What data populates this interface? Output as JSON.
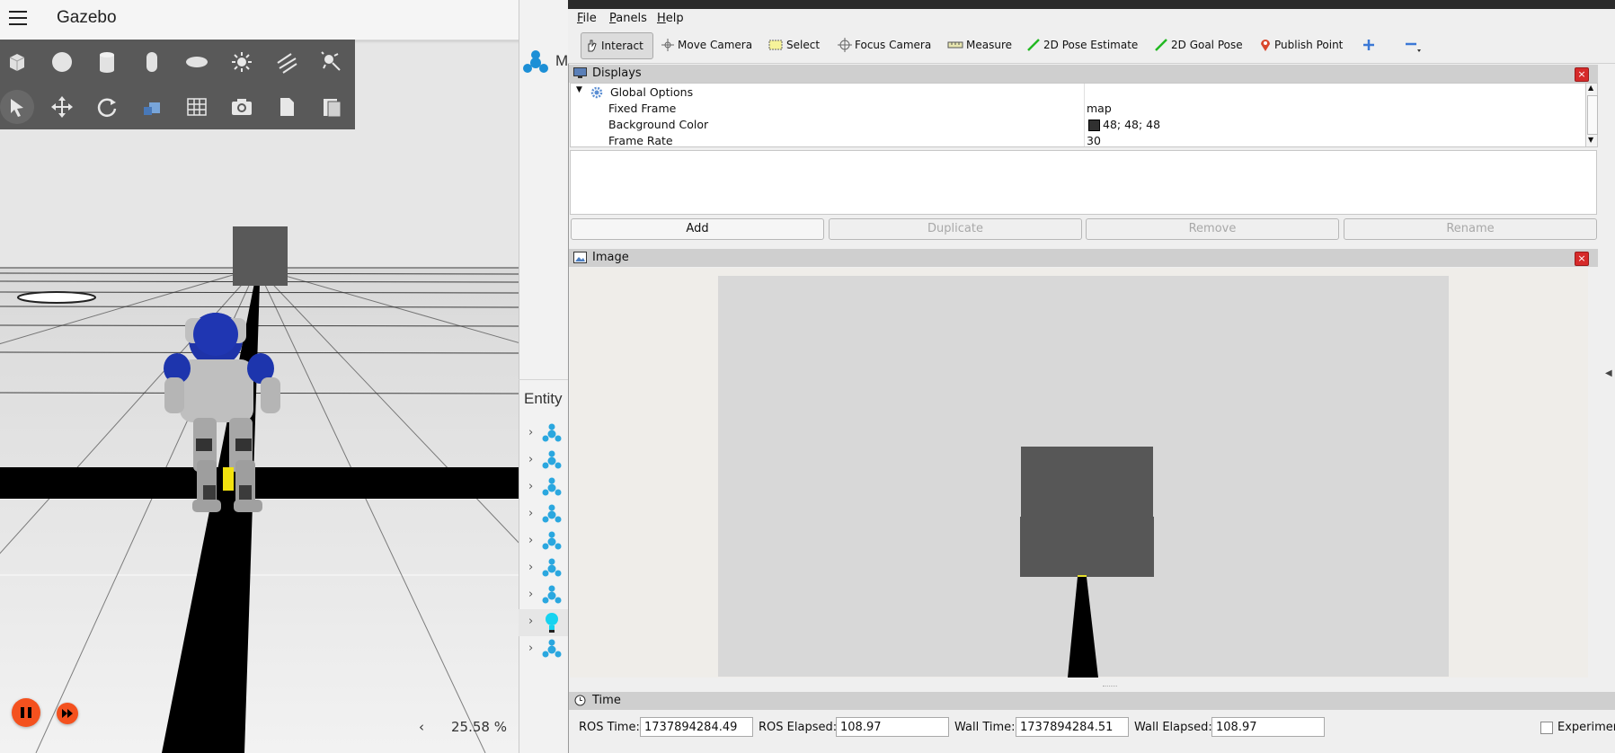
{
  "gazebo": {
    "title": "Gazebo",
    "side_panel_title_fragment": "M",
    "entity_title": "Entity",
    "zoom_level": "25.58 %",
    "zoom_chevron": "‹",
    "colors": {
      "fab": "#f4511e",
      "toolbar": "#4e4e4e"
    },
    "toolbar_row1_icons": [
      "box-icon",
      "sphere-icon",
      "cylinder-icon",
      "capsule-icon",
      "ellipsoid-icon",
      "sun-light-icon",
      "directional-light-icon",
      "spot-light-icon"
    ],
    "toolbar_row2_icons": [
      "select-arrow-icon",
      "translate-icon",
      "rotate-icon",
      "view-angle-icon",
      "grid-snap-icon",
      "screenshot-icon",
      "copy-icon",
      "paste-icon"
    ],
    "entity_icons": [
      "model-icon",
      "model-icon",
      "model-icon",
      "model-icon",
      "model-icon",
      "model-icon",
      "model-icon",
      "light-bulb-icon",
      "model-icon"
    ]
  },
  "rviz": {
    "menu": {
      "file": "File",
      "panels": "Panels",
      "help": "Help"
    },
    "tools": {
      "interact": "Interact",
      "move_camera": "Move Camera",
      "select": "Select",
      "focus_camera": "Focus Camera",
      "measure": "Measure",
      "pose_estimate": "2D Pose Estimate",
      "goal_pose": "2D Goal Pose",
      "publish_point": "Publish Point"
    },
    "displays": {
      "title": "Displays",
      "global_options": "Global Options",
      "rows": [
        {
          "name": "Fixed Frame",
          "value": "map"
        },
        {
          "name": "Background Color",
          "value": "48; 48; 48",
          "swatch": "#303030"
        },
        {
          "name": "Frame Rate",
          "value": "30"
        }
      ],
      "buttons": {
        "add": "Add",
        "duplicate": "Duplicate",
        "remove": "Remove",
        "rename": "Rename"
      }
    },
    "image_panel": {
      "title": "Image"
    },
    "time_panel": {
      "title": "Time",
      "ros_time_label": "ROS Time:",
      "ros_time": "1737894284.49",
      "ros_elapsed_label": "ROS Elapsed:",
      "ros_elapsed": "108.97",
      "wall_time_label": "Wall Time:",
      "wall_time": "1737894284.51",
      "wall_elapsed_label": "Wall Elapsed:",
      "wall_elapsed": "108.97",
      "experimental_label": "Experimer"
    }
  }
}
